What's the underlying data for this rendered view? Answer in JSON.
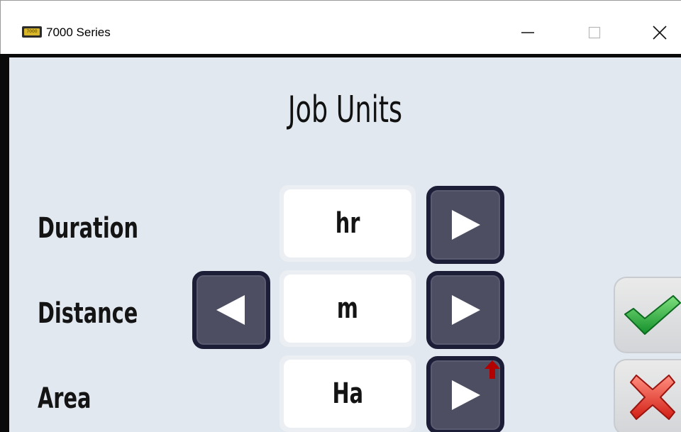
{
  "window": {
    "title": "7000 Series",
    "icon_text": "7000"
  },
  "page": {
    "title": "Job Units"
  },
  "rows": [
    {
      "label": "Duration",
      "value": "hr",
      "has_prev": false,
      "has_next": true
    },
    {
      "label": "Distance",
      "value": "m",
      "has_prev": true,
      "has_next": true
    },
    {
      "label": "Area",
      "value": "Ha",
      "has_prev": false,
      "has_next": true
    }
  ],
  "colors": {
    "background": "#e2e8ef",
    "arrow_button": "#4d4e62",
    "arrow_border": "#1c1d36",
    "confirm_check": "#2faa3a",
    "cancel_x": "#e23b2e",
    "cursor": "#b30000"
  },
  "icons": {
    "confirm": "checkmark-icon",
    "cancel": "x-icon",
    "next": "triangle-right-icon",
    "prev": "triangle-left-icon"
  }
}
